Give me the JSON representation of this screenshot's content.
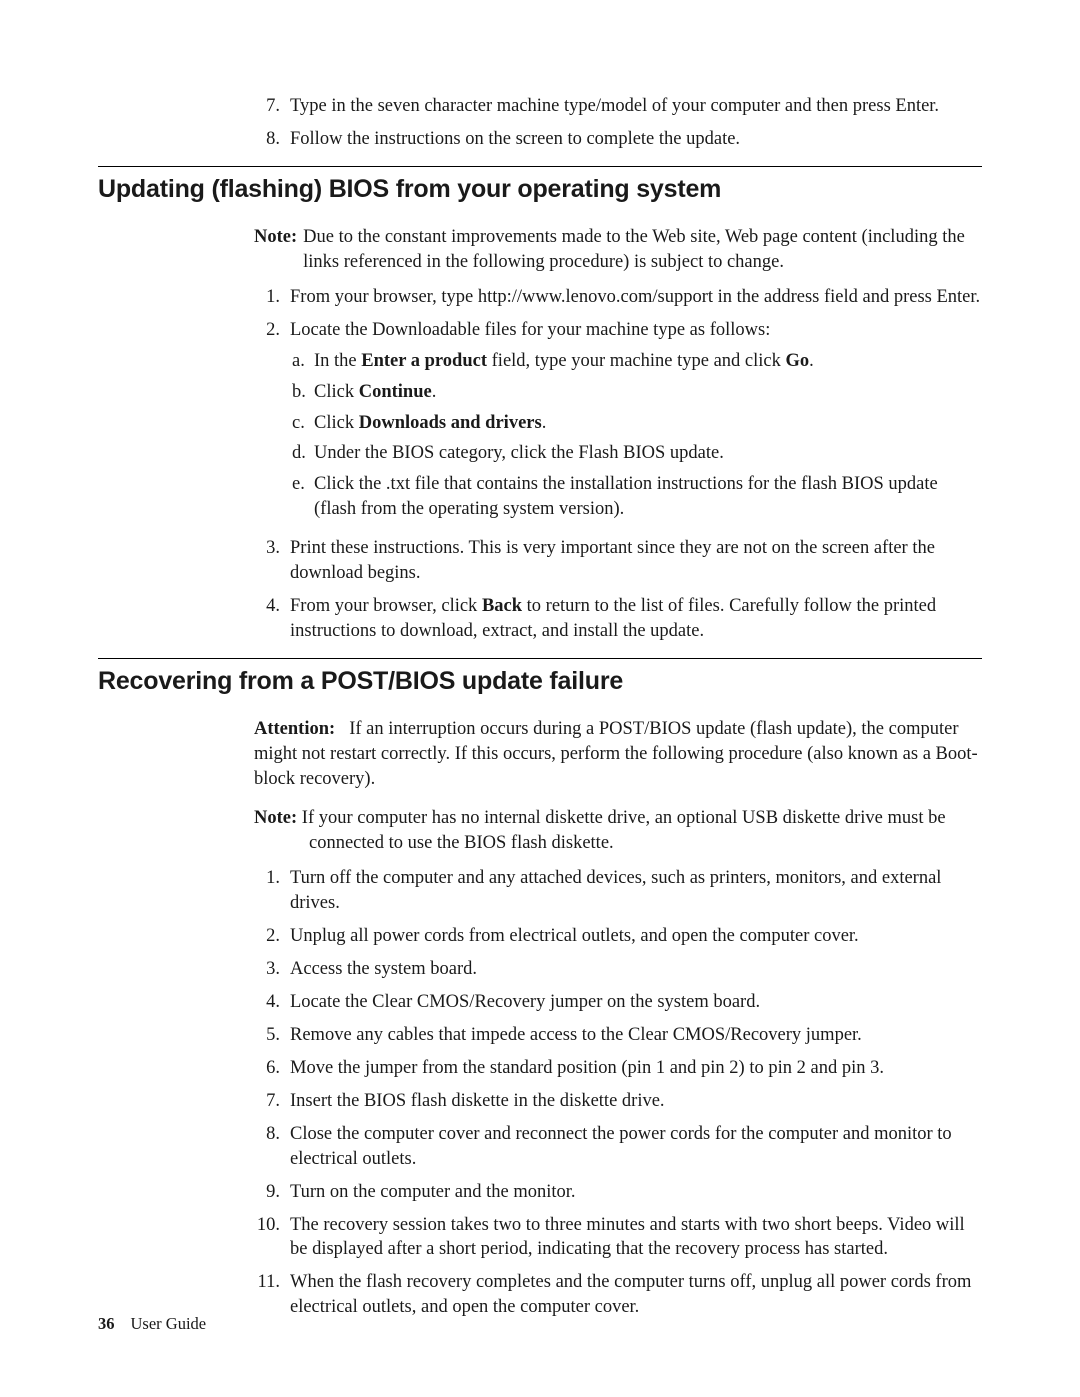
{
  "topList": {
    "item7": {
      "n": "7.",
      "text": "Type in the seven character machine type/model of your computer and then press Enter."
    },
    "item8": {
      "n": "8.",
      "text": "Follow the instructions on the screen to complete the update."
    }
  },
  "section1": {
    "heading": "Updating (flashing) BIOS from your operating system",
    "noteLabel": "Note:",
    "noteText": "Due to the constant improvements made to the Web site, Web page content (including the links referenced in the following procedure) is subject to change.",
    "list": {
      "i1": {
        "n": "1.",
        "text": "From your browser, type http://www.lenovo.com/support in the address field and press Enter."
      },
      "i2": {
        "n": "2.",
        "text": "Locate the Downloadable files for your machine type as follows:",
        "sub": {
          "a": {
            "m": "a.",
            "pre": "In the ",
            "b1": "Enter a product",
            "mid": " field, type your machine type and click ",
            "b2": "Go",
            "post": "."
          },
          "b": {
            "m": "b.",
            "pre": "Click ",
            "b1": "Continue",
            "post": "."
          },
          "c": {
            "m": "c.",
            "pre": "Click ",
            "b1": "Downloads and drivers",
            "post": "."
          },
          "d": {
            "m": "d.",
            "text": "Under the BIOS category, click the Flash BIOS update."
          },
          "e": {
            "m": "e.",
            "text": "Click the .txt file that contains the installation instructions for the flash BIOS update (flash from the operating system version)."
          }
        }
      },
      "i3": {
        "n": "3.",
        "text": "Print these instructions. This is very important since they are not on the screen after the download begins."
      },
      "i4": {
        "n": "4.",
        "pre": "From your browser, click ",
        "b1": "Back",
        "post": " to return to the list of files. Carefully follow the printed instructions to download, extract, and install the update."
      }
    }
  },
  "section2": {
    "heading": "Recovering from a POST/BIOS update failure",
    "attnLabel": "Attention:",
    "attnText": "If an interruption occurs during a POST/BIOS update (flash update), the computer might not restart correctly. If this occurs, perform the following procedure (also known as a Boot-block recovery).",
    "noteLabel": "Note:",
    "noteText": "If your computer has no internal diskette drive, an optional USB diskette drive must be connected to use the BIOS flash diskette.",
    "list": {
      "i1": {
        "n": "1.",
        "text": "Turn off the computer and any attached devices, such as printers, monitors, and external drives."
      },
      "i2": {
        "n": "2.",
        "text": "Unplug all power cords from electrical outlets, and open the computer cover."
      },
      "i3": {
        "n": "3.",
        "text": "Access the system board."
      },
      "i4": {
        "n": "4.",
        "text": "Locate the Clear CMOS/Recovery jumper on the system board."
      },
      "i5": {
        "n": "5.",
        "text": "Remove any cables that impede access to the Clear CMOS/Recovery jumper."
      },
      "i6": {
        "n": "6.",
        "text": "Move the jumper from the standard position (pin 1 and pin 2) to pin 2 and pin 3."
      },
      "i7": {
        "n": "7.",
        "text": "Insert the BIOS flash diskette in the diskette drive."
      },
      "i8": {
        "n": "8.",
        "text": "Close the computer cover and reconnect the power cords for the computer and monitor to electrical outlets."
      },
      "i9": {
        "n": "9.",
        "text": "Turn on the computer and the monitor."
      },
      "i10": {
        "n": "10.",
        "text": "The recovery session takes two to three minutes and starts with two short beeps. Video will be displayed after a short period, indicating that the recovery process has started."
      },
      "i11": {
        "n": "11.",
        "text": "When the flash recovery completes and the computer turns off, unplug all power cords from electrical outlets, and open the computer cover."
      }
    }
  },
  "footer": {
    "page": "36",
    "title": "User Guide"
  }
}
